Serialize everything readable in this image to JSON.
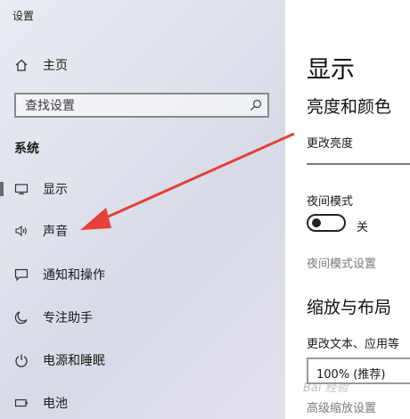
{
  "app_title": "设置",
  "sidebar": {
    "home_label": "主页",
    "search_placeholder": "查找设置",
    "section_label": "系统",
    "items": [
      {
        "label": "显示",
        "icon": "monitor-icon"
      },
      {
        "label": "声音",
        "icon": "speaker-icon"
      },
      {
        "label": "通知和操作",
        "icon": "notification-icon"
      },
      {
        "label": "专注助手",
        "icon": "moon-icon"
      },
      {
        "label": "电源和睡眠",
        "icon": "power-icon"
      },
      {
        "label": "电池",
        "icon": "battery-icon"
      }
    ],
    "selected_item": "显示"
  },
  "main": {
    "page_title": "显示",
    "brightness_section_title": "亮度和颜色",
    "brightness_label": "更改亮度",
    "night_mode_label": "夜间模式",
    "night_mode_state": "关",
    "night_mode_settings_link": "夜间模式设置",
    "scale_section_title": "缩放与布局",
    "scale_label": "更改文本、应用等",
    "scale_value": "100% (推荐)",
    "advanced_scale_link": "高级缩放设置"
  },
  "overlay": {
    "watermark": "Bai 经验",
    "arrow_color": "#e8403a"
  }
}
